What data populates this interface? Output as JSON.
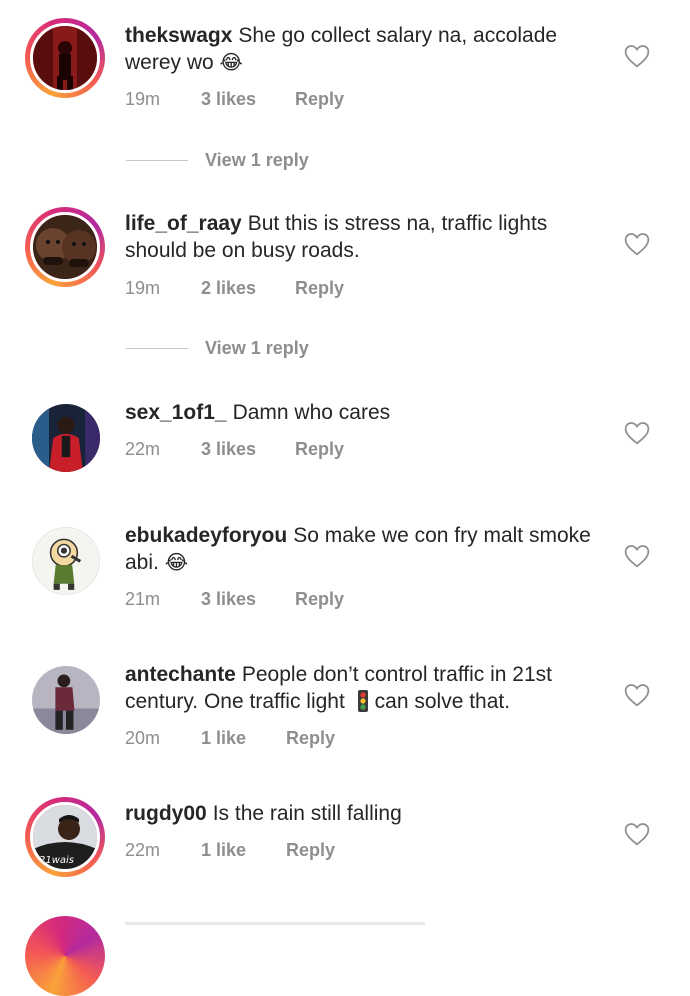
{
  "comments": [
    {
      "username": "thekswagx",
      "text": "She go collect salary na, accolade werey wo",
      "emoji": "😂",
      "time": "19m",
      "likes": "3 likes",
      "reply": "Reply",
      "view_replies": "View 1 reply"
    },
    {
      "username": "life_of_raay",
      "text": "But this is stress na, traffic lights should be on busy roads.",
      "emoji": "",
      "time": "19m",
      "likes": "2 likes",
      "reply": "Reply",
      "view_replies": "View 1 reply"
    },
    {
      "username": "sex_1of1_",
      "text": "Damn who cares",
      "emoji": "",
      "time": "22m",
      "likes": "3 likes",
      "reply": "Reply"
    },
    {
      "username": "ebukadeyforyou",
      "text": "So make we con fry malt smoke abi.",
      "emoji": "😂",
      "time": "21m",
      "likes": "3 likes",
      "reply": "Reply"
    },
    {
      "username": "antechante",
      "text": "People don’t control traffic in 21st century.  One traffic light",
      "emoji": "🚦",
      "text_after": "can solve that.",
      "time": "20m",
      "likes": "1 like",
      "reply": "Reply"
    },
    {
      "username": "rugdy00",
      "text": "Is the rain still falling",
      "emoji": "",
      "time": "22m",
      "likes": "1 like",
      "reply": "Reply"
    }
  ],
  "icons": {
    "like": "heart-outline-icon"
  },
  "colors": {
    "text": "#262626",
    "meta": "#8e8e8e",
    "story_ring": "#d62a7a"
  }
}
